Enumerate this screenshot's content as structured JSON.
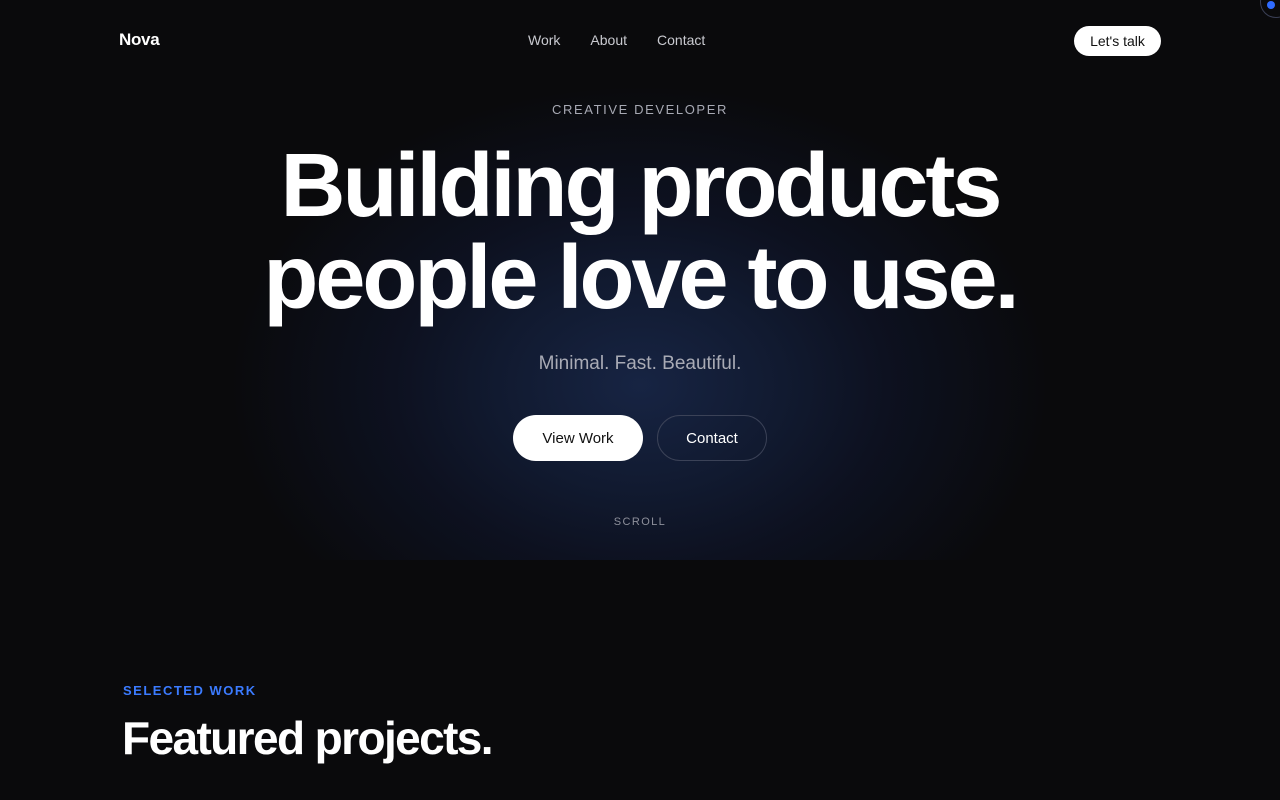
{
  "nav": {
    "logo": "Nova",
    "links": [
      "Work",
      "About",
      "Contact"
    ],
    "cta_label": "Let's talk"
  },
  "hero": {
    "eyebrow": "CREATIVE DEVELOPER",
    "headline_line1": "Building products",
    "headline_line2": "people love to use.",
    "subhead": "Minimal. Fast. Beautiful.",
    "primary_button": "View Work",
    "secondary_button": "Contact",
    "scroll_hint": "SCROLL"
  },
  "work": {
    "eyebrow": "SELECTED WORK",
    "title": "Featured projects."
  },
  "colors": {
    "background": "#0a0a0c",
    "accent": "#3b7bff",
    "glow": "#172443",
    "text_primary": "#ffffff",
    "text_muted": "#a9abb5"
  }
}
